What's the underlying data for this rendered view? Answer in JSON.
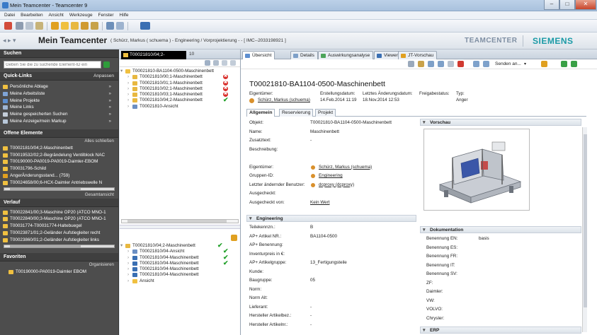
{
  "window": {
    "title": "Mein Teamcenter - Teamcenter 9",
    "minimize": "–",
    "maximize": "□",
    "close": "✕"
  },
  "menu": [
    "Datei",
    "Bearbeiten",
    "Ansicht",
    "Werkzeuge",
    "Fenster",
    "Hilfe"
  ],
  "brand": {
    "nav": "◂ ▸ ▾",
    "app_title": "Mein Teamcenter",
    "context": "( Schürz, Markus ( schuema ) - Engineering / Vorprojektierung - - [ IMC--2033198921 ]",
    "teamcenter": "TEAMCENTER",
    "siemens": "SIEMENS"
  },
  "left": {
    "search_title": "Suchen",
    "search_placeholder": "Geben Sie die zu suchende Element-ID ein",
    "quicklinks_title": "Quick-Links",
    "quicklinks_action": "Anpassen",
    "quicklinks": [
      "Persönliche Ablage",
      "Meine Arbeitsliste",
      "Meine Projekte",
      "Meine Links",
      "Meine gespeicherten Suchen",
      "Meine Anzeige/mein Markup"
    ],
    "open_title": "Offene Elemente",
    "open_action": "Alles schließen",
    "open_items": [
      "T00021810/04;2-Maschinenbett",
      "T00019532/02;2-Begrändelung Ventilblock NAC",
      "T00190000-PA0019-PA0019-Daimler-EBOM",
      "T00031796-Schild",
      "AngerÄnderungsstand... (759)",
      "T00024658/00;6-HCX-Daimler Antriebswelle N"
    ],
    "open_more": "Gesamtansicht",
    "history_title": "Verlauf",
    "history_items": [
      "T00022841/00;3-Maschine OP20 (ATCO MNO-1",
      "T00022840/00;3-Maschine OP20 (ATCO MNO-1",
      "T00031774-T00031774-Haltebuegel",
      "T00023871/01;2-Geländer Aufstiegleiter recht",
      "T00023860/01;2-Geländer Aufstiegleiter links"
    ],
    "favorites_title": "Favoriten",
    "favorites_action": "Organisieren",
    "favorites": [
      "T00190000-PA0019-Daimler EBOM"
    ]
  },
  "tree": {
    "tab_label": "T00021810/04;2-",
    "tab_extra": "10",
    "top_rows": [
      {
        "label": "T00021810-BA1104-0500-Maschinenbett",
        "status": "",
        "indent": 0,
        "icon": "folder"
      },
      {
        "label": "T00021810/00;1-Maschinenbett",
        "status": "err",
        "indent": 1,
        "icon": "item"
      },
      {
        "label": "T00021810/01;1-Maschinenbett",
        "status": "err",
        "indent": 1,
        "icon": "item"
      },
      {
        "label": "T00021810/02;1-Maschinenbett",
        "status": "err",
        "indent": 1,
        "icon": "item"
      },
      {
        "label": "T00021810/03;1-Maschinenbett",
        "status": "err",
        "indent": 1,
        "icon": "item"
      },
      {
        "label": "T00021810/04;2-Maschinenbett",
        "status": "ok",
        "indent": 1,
        "icon": "item"
      },
      {
        "label": "T00021810-Ansicht",
        "status": "",
        "indent": 1,
        "icon": "view"
      }
    ],
    "bottom_rows": [
      {
        "label": "T00021810/04;2-Maschinenbett",
        "status": "ok",
        "indent": 0,
        "icon": "item"
      },
      {
        "label": "T00021810/04-Ansicht",
        "status": "ok",
        "indent": 1,
        "icon": "view"
      },
      {
        "label": "T00021810/04-Maschinenbett",
        "status": "ok",
        "indent": 1,
        "icon": "img"
      },
      {
        "label": "T00021810/04-Maschinenbett",
        "status": "ok",
        "indent": 1,
        "icon": "img"
      },
      {
        "label": "T00021810/04-Maschinenbett",
        "status": "",
        "indent": 1,
        "icon": "img"
      },
      {
        "label": "T00021810/04-Maschinenbett",
        "status": "",
        "indent": 1,
        "icon": "img"
      },
      {
        "label": "Ansicht",
        "status": "",
        "indent": 1,
        "icon": "folder"
      }
    ]
  },
  "main": {
    "tabs": [
      "Übersicht",
      "Details",
      "Auswirkungsanalyse",
      "Viewer",
      "JT-Vorschau"
    ],
    "send_label": "Senden an...",
    "object_title": "T00021810-BA1104-0500-Maschinenbett",
    "header_labels": {
      "owner": "Eigentümer:",
      "created": "Erstellungsdatum:",
      "changed": "Letztes Änderungsdatum:",
      "release": "Freigabestatus:",
      "type": "Typ:"
    },
    "header_values": {
      "owner": "Schürz, Markus (schuema)",
      "created": "14.Feb.2014 11:19",
      "changed": "18.Nov.2014 12:53",
      "release": "",
      "type": "Anger"
    },
    "subtabs": [
      "Allgemein",
      "Reservierung",
      "Projekt"
    ],
    "general": [
      {
        "k": "Objekt:",
        "v": "T00021810-BA1104-0500-Maschinenbett",
        "link": false
      },
      {
        "k": "Name:",
        "v": "Maschinenbett",
        "link": false
      },
      {
        "k": "Zusatztext:",
        "v": "-",
        "link": false
      },
      {
        "k": "Beschreibung:",
        "v": "",
        "link": false
      },
      {
        "k": "",
        "v": "",
        "link": false
      },
      {
        "k": "Eigentümer:",
        "v": "Schürz, Markus (schuema)",
        "link": true,
        "icon": true
      },
      {
        "k": "Gruppen-ID:",
        "v": "Engineering",
        "link": true,
        "icon": true
      },
      {
        "k": "Letzter ändernder Benutzer:",
        "v": "dcproxy (dcproxy)",
        "link": true,
        "icon": true
      },
      {
        "k": "Ausgecheckt:",
        "v": "",
        "link": false
      },
      {
        "k": "Ausgecheckt von:",
        "v": "Kein Wert",
        "link": true
      }
    ],
    "engineering_title": "Engineering",
    "engineering": [
      {
        "k": "Teilekennzn.:",
        "v": "B"
      },
      {
        "k": "AP+ Artikel NR.:",
        "v": "BA1104-0500"
      },
      {
        "k": "AP+ Benennung:",
        "v": ""
      },
      {
        "k": "Inventurpreis in €:",
        "v": ""
      },
      {
        "k": "AP+ Artikelgruppe:",
        "v": "13_Fertigungsteile"
      },
      {
        "k": "Kunde:",
        "v": ""
      },
      {
        "k": "Baugruppe:",
        "v": "05"
      },
      {
        "k": "Norm:",
        "v": ""
      },
      {
        "k": "Norm Alt:",
        "v": ""
      },
      {
        "k": "Lieferant:",
        "v": "-"
      },
      {
        "k": "Hersteller Artikelbez.:",
        "v": "-"
      },
      {
        "k": "Hersteller Artikelnr.:",
        "v": "-"
      }
    ],
    "preview_title": "Vorschau",
    "doc_title": "Dokumentation",
    "docs": [
      {
        "k": "Benennung EN:",
        "v": "basis"
      },
      {
        "k": "Benennung ES:",
        "v": ""
      },
      {
        "k": "Benennung FR:",
        "v": ""
      },
      {
        "k": "Benennung IT:",
        "v": ""
      },
      {
        "k": "Benennung SV:",
        "v": ""
      },
      {
        "k": "ZF:",
        "v": ""
      },
      {
        "k": "Daimler:",
        "v": ""
      },
      {
        "k": "VW:",
        "v": ""
      },
      {
        "k": "VOLVO:",
        "v": ""
      },
      {
        "k": "Chrysler:",
        "v": ""
      }
    ],
    "erp_title": "ERP"
  },
  "colors": {
    "leftnav_bg": "#4d4d4d",
    "accent_green": "#22a02a",
    "error_red": "#d9302c",
    "siemens": "#1a9aa6"
  }
}
